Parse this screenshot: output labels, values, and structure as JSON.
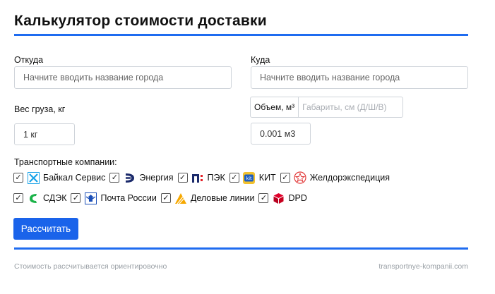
{
  "header": {
    "title": "Калькулятор стоимости доставки"
  },
  "from": {
    "label": "Откуда",
    "placeholder": "Начните вводить название города"
  },
  "to": {
    "label": "Куда",
    "placeholder": "Начните вводить название города"
  },
  "weight": {
    "label": "Вес груза, кг",
    "value": "1 кг"
  },
  "volume": {
    "active_tab": "Объем, м³",
    "inactive_tab": "Габариты, см (Д/Ш/В)",
    "value": "0.001 м3"
  },
  "companies": {
    "label": "Транспортные компании:",
    "row1": [
      {
        "name": "Байкал Сервис",
        "checked": true,
        "icon": "baikal-logo-icon"
      },
      {
        "name": "Энергия",
        "checked": true,
        "icon": "energiya-logo-icon"
      },
      {
        "name": "ПЭК",
        "checked": true,
        "icon": "pek-logo-icon"
      },
      {
        "name": "КИТ",
        "checked": true,
        "icon": "kit-logo-icon"
      },
      {
        "name": "Желдорэкспедиция",
        "checked": true,
        "icon": "zheldor-logo-icon"
      }
    ],
    "row2": [
      {
        "name": "СДЭК",
        "checked": true,
        "icon": "cdek-logo-icon"
      },
      {
        "name": "Почта России",
        "checked": true,
        "icon": "pochta-logo-icon"
      },
      {
        "name": "Деловые линии",
        "checked": true,
        "icon": "delovye-logo-icon"
      },
      {
        "name": "DPD",
        "checked": true,
        "icon": "dpd-logo-icon"
      }
    ]
  },
  "actions": {
    "calculate": "Рассчитать"
  },
  "footer": {
    "note": "Стоимость рассчитывается ориентировочно",
    "site": "transportnye-kompanii.com"
  },
  "colors": {
    "accent": "#1f6cf0",
    "button": "#1a63ea"
  }
}
